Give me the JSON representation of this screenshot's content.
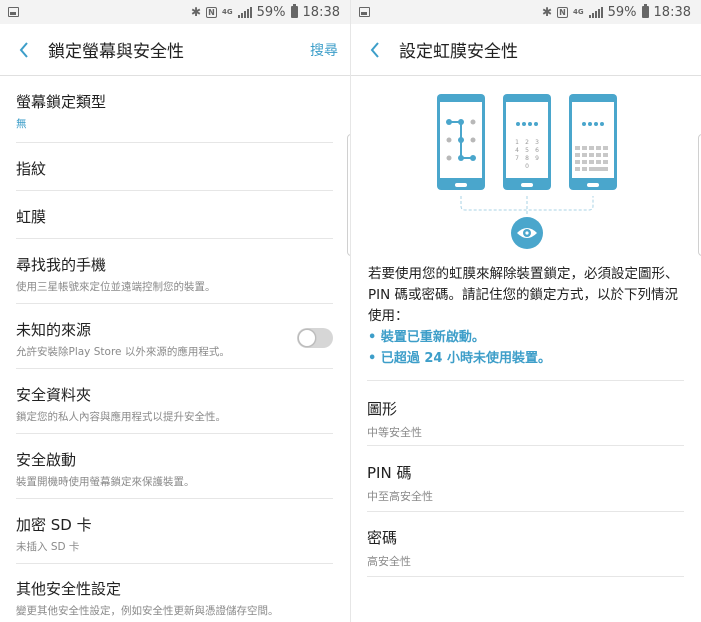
{
  "status": {
    "battery": "59%",
    "time": "18:38",
    "network": "4G"
  },
  "left": {
    "title": "鎖定螢幕與安全性",
    "action": "搜尋",
    "items": [
      {
        "title": "螢幕鎖定類型",
        "sub": "無"
      },
      {
        "title": "指紋"
      },
      {
        "title": "虹膜"
      },
      {
        "title": "尋找我的手機",
        "sub": "使用三星帳號來定位並遠端控制您的裝置。"
      },
      {
        "title": "未知的來源",
        "sub": "允許安裝除Play Store 以外來源的應用程式。"
      },
      {
        "title": "安全資料夾",
        "sub": "鎖定您的私人內容與應用程式以提升安全性。"
      },
      {
        "title": "安全啟動",
        "sub": "裝置開機時使用螢幕鎖定來保護裝置。"
      },
      {
        "title": "加密 SD 卡",
        "sub": "未插入 SD 卡"
      },
      {
        "title": "其他安全性設定",
        "sub": "變更其他安全性設定，例如安全性更新與憑證儲存空間。"
      }
    ]
  },
  "right": {
    "title": "設定虹膜安全性",
    "info_lines": [
      "若要使用您的虹膜來解除裝置鎖定，必須設定圖形、",
      "PIN 碼或密碼。請記住您的鎖定方式，以於下列情況",
      "使用："
    ],
    "bullets": [
      "• 裝置已重新啟動。",
      "• 已超過 24 小時未使用裝置。"
    ],
    "pin_keys": [
      "1",
      "2",
      "3",
      "4",
      "5",
      "6",
      "7",
      "8",
      "9",
      "0"
    ],
    "options": [
      {
        "title": "圖形",
        "sub": "中等安全性"
      },
      {
        "title": "PIN 碼",
        "sub": "中至高安全性"
      },
      {
        "title": "密碼",
        "sub": "高安全性"
      }
    ]
  },
  "colors": {
    "accent": "#3d9ec9",
    "phone": "#4aa6cc",
    "toggle_off": "#d6d6d6"
  }
}
